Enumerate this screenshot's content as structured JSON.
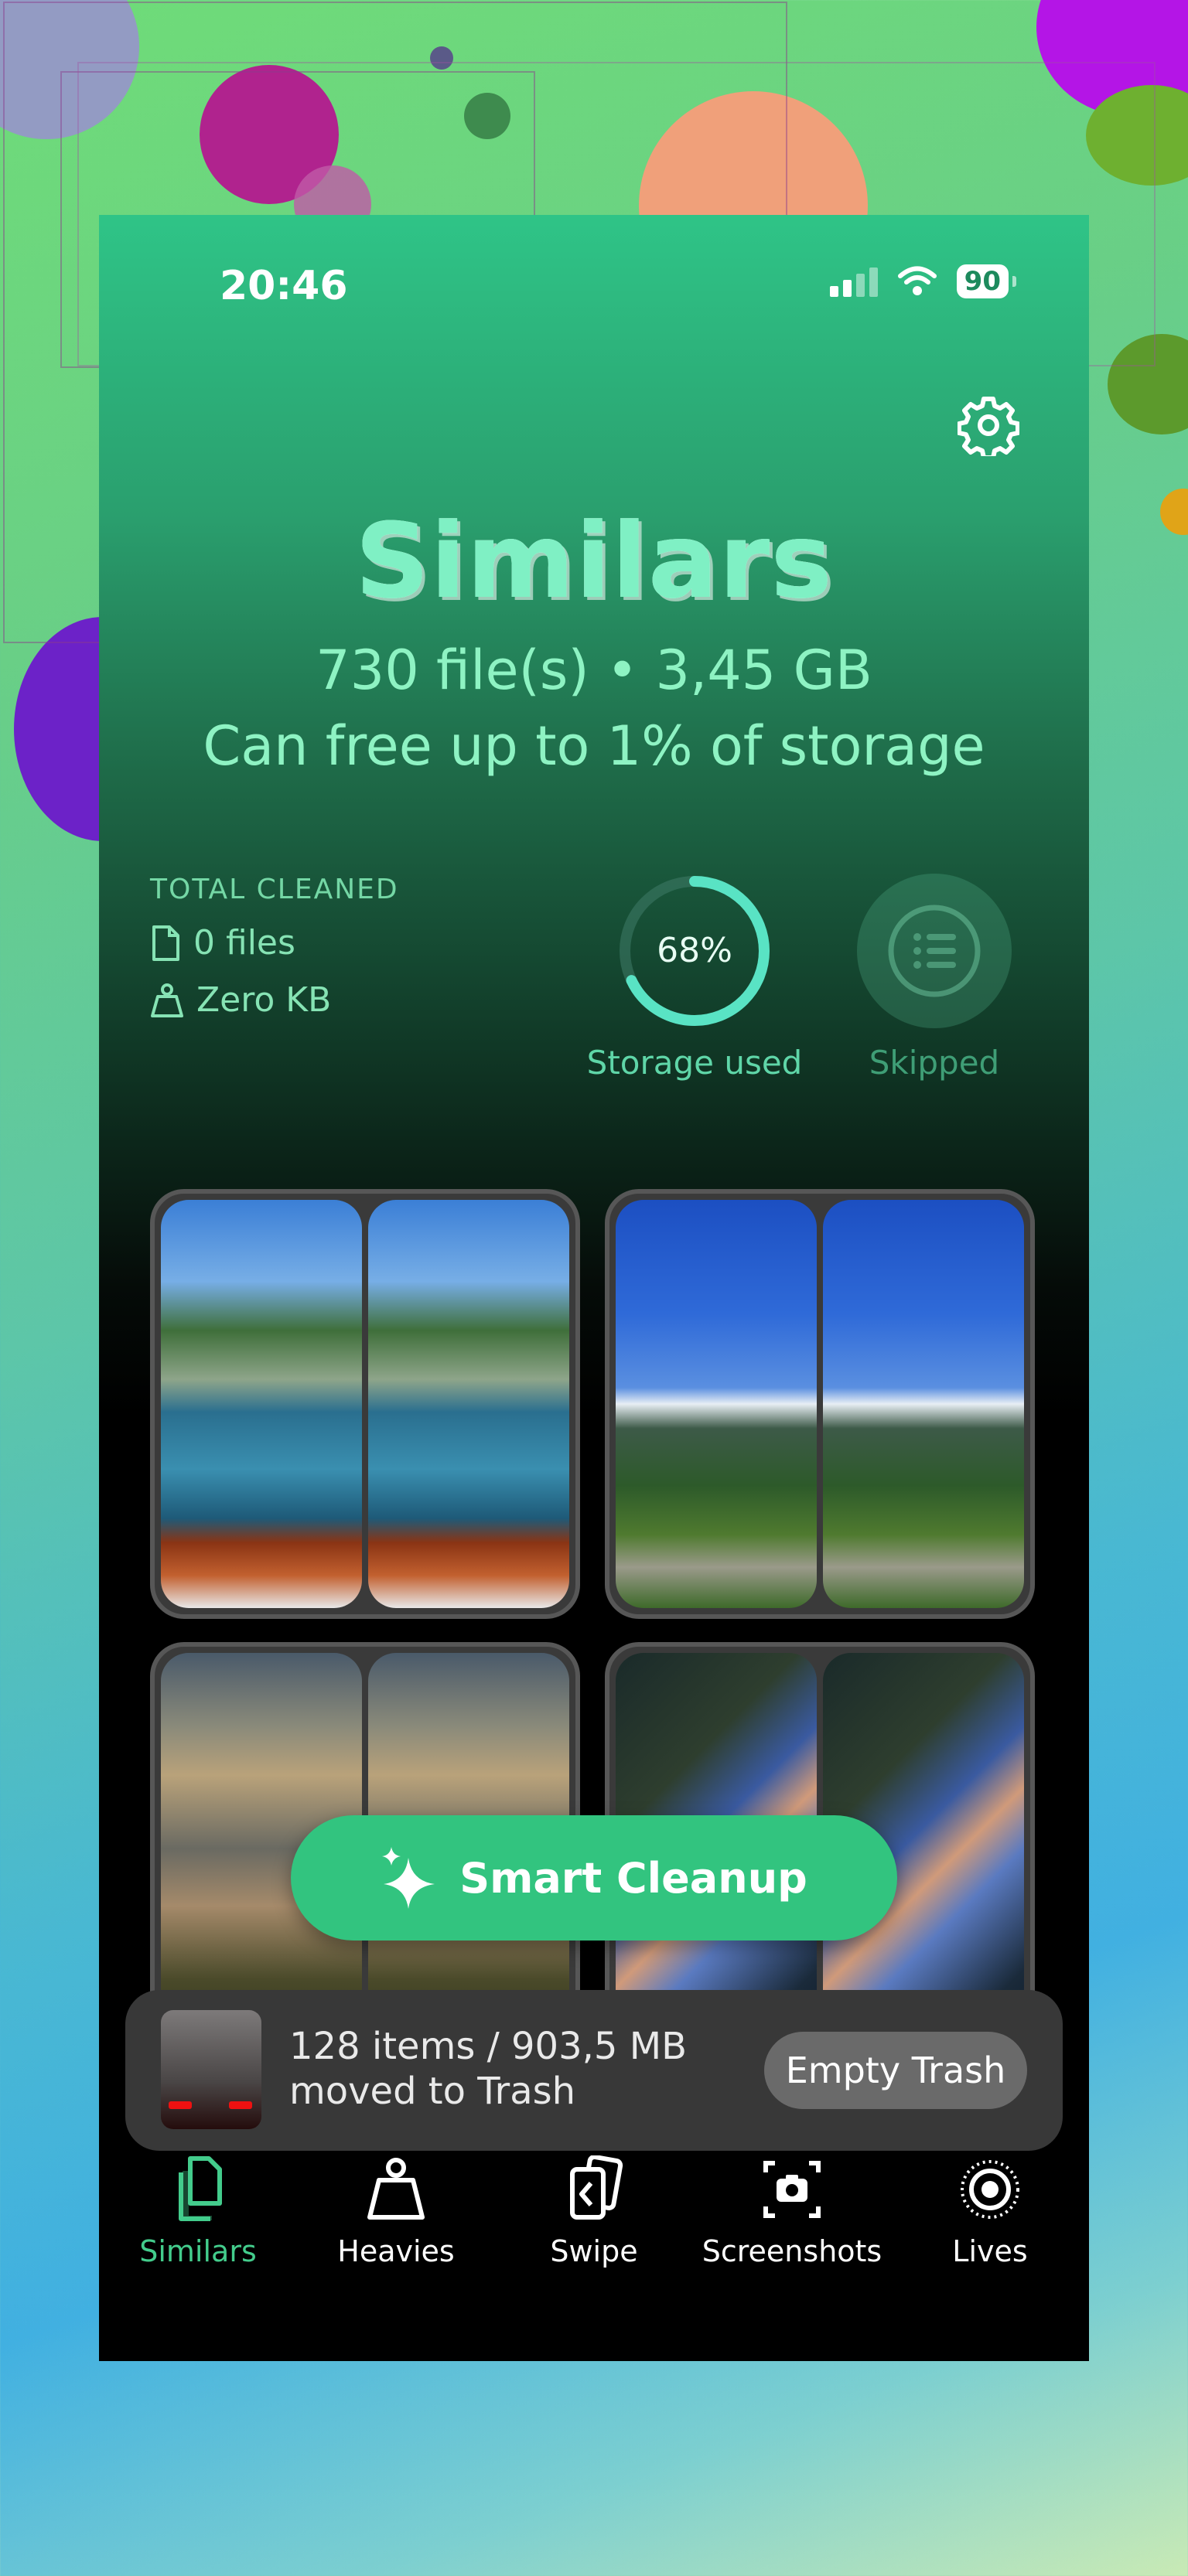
{
  "status_bar": {
    "time": "20:46",
    "battery": "90"
  },
  "header": {
    "title": "Similars",
    "file_summary": "730 file(s) • 3,45 GB",
    "storage_note": "Can free up to 1% of storage"
  },
  "total_cleaned": {
    "label": "TOTAL CLEANED",
    "files": "0 files",
    "size": "Zero KB"
  },
  "storage": {
    "percent_text": "68%",
    "fraction": 0.68,
    "label": "Storage used"
  },
  "skipped": {
    "label": "Skipped",
    "icon": "list-icon"
  },
  "smart_cleanup": {
    "label": "Smart Cleanup",
    "icon": "sparkles-icon"
  },
  "trash": {
    "summary_line1": "128 items / 903,5 MB",
    "summary_line2": "moved to Trash",
    "button": "Empty Trash"
  },
  "tabs": [
    {
      "label": "Similars",
      "icon": "copy-icon",
      "active": true
    },
    {
      "label": "Heavies",
      "icon": "weight-icon",
      "active": false
    },
    {
      "label": "Swipe",
      "icon": "swipe-cards-icon",
      "active": false
    },
    {
      "label": "Screenshots",
      "icon": "screenshot-icon",
      "active": false
    },
    {
      "label": "Lives",
      "icon": "live-photo-icon",
      "active": false
    }
  ],
  "colors": {
    "accent": "#32c47f",
    "ring": "#59e3c4",
    "active_tab": "#43cc8c"
  }
}
